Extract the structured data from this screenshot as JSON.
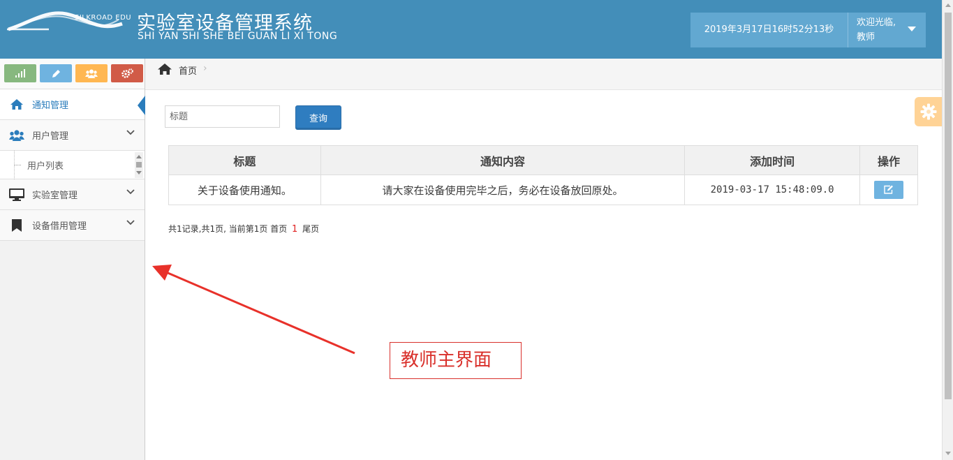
{
  "header": {
    "logo_text": "SILKROAD EDU",
    "title": "实验室设备管理系统",
    "subtitle": "SHI YAN SHI SHE BEI GUAN LI XI TONG",
    "datetime": "2019年3月17日16时52分13秒",
    "welcome": "欢迎光临,",
    "role": "教师"
  },
  "sidebar": {
    "shortcuts": [
      {
        "icon": "signal-icon",
        "color": "#87b87f"
      },
      {
        "icon": "pencil-icon",
        "color": "#6fb3e0"
      },
      {
        "icon": "users-icon",
        "color": "#ffb752"
      },
      {
        "icon": "cogs-icon",
        "color": "#d15b47"
      }
    ],
    "items": [
      {
        "label": "通知管理",
        "icon": "home-icon",
        "active": true
      },
      {
        "label": "用户管理",
        "icon": "users-icon",
        "expanded": true,
        "children": [
          {
            "label": "用户列表"
          }
        ]
      },
      {
        "label": "实验室管理",
        "icon": "desktop-icon"
      },
      {
        "label": "设备借用管理",
        "icon": "bookmark-icon"
      }
    ]
  },
  "breadcrumb": {
    "home": "首页"
  },
  "search": {
    "placeholder": "标题",
    "button": "查询"
  },
  "table": {
    "headers": [
      "标题",
      "通知内容",
      "添加时间",
      "操作"
    ],
    "rows": [
      {
        "title": "关于设备使用通知。",
        "content": "请大家在设备使用完毕之后，务必在设备放回原处。",
        "time": "2019-03-17 15:48:09.0"
      }
    ]
  },
  "pagination": {
    "summary": "共1记录,共1页, 当前第1页",
    "first": "首页",
    "current": "1",
    "last": "尾页"
  },
  "annotation": {
    "text": "教师主界面",
    "color": "#d9302b"
  },
  "colors": {
    "header_bg": "#438eb9",
    "accent": "#2b7dbc"
  }
}
